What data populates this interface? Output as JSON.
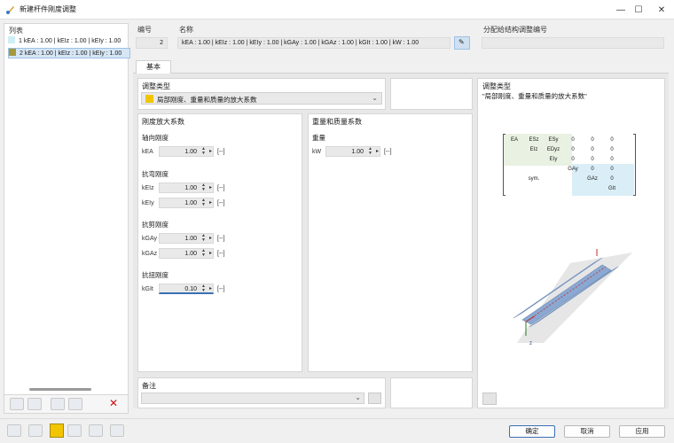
{
  "window": {
    "title": "新建杆件刚度调整",
    "minimize": "—",
    "maximize": "☐",
    "close": "✕"
  },
  "list": {
    "header": "列表",
    "items": [
      {
        "text": "1  kEA : 1.00 | kEIz : 1.00 | kEIy : 1.00",
        "color": "#cdeef4"
      },
      {
        "text": "2  kEA : 1.00 | kEIz : 1.00 | kEIy : 1.00",
        "color": "#a39a40"
      }
    ]
  },
  "header": {
    "number_label": "编号",
    "number_value": "2",
    "name_label": "名称",
    "name_value": "kEA : 1.00 | kEIz : 1.00 | kEIy : 1.00 | kGAy : 1.00 | kGAz : 1.00 | kGIt : 1.00 | kW : 1.00",
    "assign_label": "分配给结构调整编号"
  },
  "tabs": [
    {
      "label": "基本"
    }
  ],
  "adjust_type": {
    "label": "调整类型",
    "value": "局部刚度、重量和质量的放大系数",
    "color": "#f2c500"
  },
  "stiffness": {
    "title": "刚度放大系数",
    "groups": [
      {
        "label": "轴向刚度",
        "rows": [
          {
            "key": "kEA",
            "value": "1.00",
            "unit": "[--]"
          }
        ]
      },
      {
        "label": "抗弯刚度",
        "rows": [
          {
            "key": "kEIz",
            "value": "1.00",
            "unit": "[--]"
          },
          {
            "key": "kEIy",
            "value": "1.00",
            "unit": "[--]"
          }
        ]
      },
      {
        "label": "抗剪刚度",
        "rows": [
          {
            "key": "kGAy",
            "value": "1.00",
            "unit": "[--]"
          },
          {
            "key": "kGAz",
            "value": "1.00",
            "unit": "[--]"
          }
        ]
      },
      {
        "label": "抗扭刚度",
        "rows": [
          {
            "key": "kGIt",
            "value": "0.10",
            "unit": "[--]"
          }
        ]
      }
    ]
  },
  "weight": {
    "title": "重量和质量系数",
    "group_label": "重量",
    "row": {
      "key": "kW",
      "value": "1.00",
      "unit": "[--]"
    }
  },
  "notes": {
    "label": "备注"
  },
  "info_panel": {
    "title": "调整类型",
    "subtitle": "\"局部刚度、重量和质量的放大系数\"",
    "matrix": [
      [
        "EA",
        "ESz",
        "ESy",
        "0",
        "0",
        "0"
      ],
      [
        "",
        "EIz",
        "EDyz",
        "0",
        "0",
        "0"
      ],
      [
        "",
        "",
        "EIy",
        "0",
        "0",
        "0"
      ],
      [
        "",
        "",
        "",
        "GAy",
        "0",
        "0"
      ],
      [
        "",
        "sym.",
        "",
        "",
        "GAz",
        "0"
      ],
      [
        "",
        "",
        "",
        "",
        "",
        "GIt"
      ]
    ],
    "axis_z": "z"
  },
  "buttons": {
    "ok": "确定",
    "cancel": "取消",
    "apply": "应用"
  }
}
